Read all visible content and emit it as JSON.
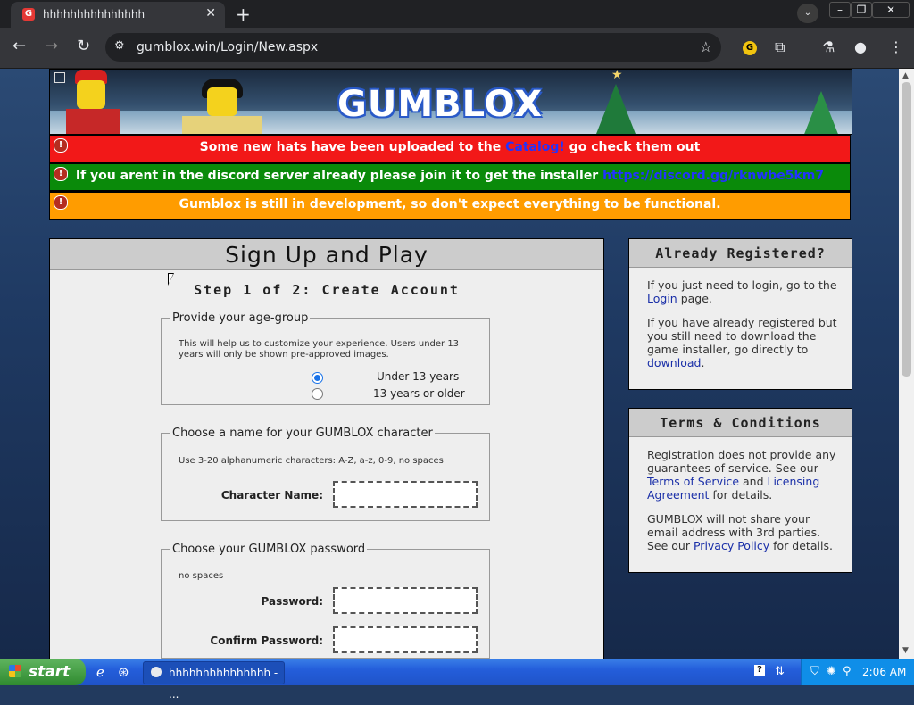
{
  "browser": {
    "tab_title": "hhhhhhhhhhhhhhh",
    "url": "gumblox.win/Login/New.aspx"
  },
  "banner": {
    "logo_text": "GUMBLOX"
  },
  "alerts": {
    "a1_pre": "Some new hats have been uploaded to the ",
    "a1_link": "Catalog!",
    "a1_post": " go check them out",
    "a2_pre": "If you arent in the discord server already please join it to get the installer ",
    "a2_link": "https://discord.gg/rknwbe5km7",
    "a3_text": "Gumblox is still in development, so don't expect everything to be functional."
  },
  "signup": {
    "title": "Sign Up and Play",
    "step": "Step 1 of 2: Create Account",
    "age": {
      "legend": "Provide your age-group",
      "hint": "This will help us to customize your experience. Users under 13 years will only be shown pre-approved images.",
      "options": [
        "Under 13 years",
        "13 years or older"
      ],
      "selected": "Under 13 years"
    },
    "name": {
      "legend": "Choose a name for your GUMBLOX character",
      "hint": "Use 3-20 alphanumeric characters: A-Z, a-z, 0-9, no spaces",
      "label": "Character Name:",
      "value": ""
    },
    "password": {
      "legend": "Choose your GUMBLOX password",
      "hint": "no spaces",
      "label": "Password:",
      "confirm_label": "Confirm Password:",
      "value": "",
      "confirm_value": ""
    }
  },
  "already": {
    "title": "Already Registered?",
    "p1_pre": "If you just need to login, go to the ",
    "p1_link": "Login",
    "p1_post": " page.",
    "p2_pre": "If you have already registered but you still need to download the game installer, go directly to ",
    "p2_link": "download",
    "p2_post": "."
  },
  "terms": {
    "title": "Terms & Conditions",
    "p1_pre": "Registration does not provide any guarantees of service. See our ",
    "p1_link1": "Terms of Service",
    "p1_mid": " and ",
    "p1_link2": "Licensing Agreement",
    "p1_post": " for details.",
    "p2_pre": "GUMBLOX will not share your email address with 3rd parties. See our ",
    "p2_link": "Privacy Policy",
    "p2_post": " for details."
  },
  "taskbar": {
    "start_label": "start",
    "task_label": "hhhhhhhhhhhhhhh - ...",
    "clock": "2:06 AM"
  },
  "colors": {
    "alert_red": "#f21818",
    "alert_green": "#0a8a0a",
    "alert_orange": "#ff9c00",
    "link_blue": "#1a2fa8"
  }
}
